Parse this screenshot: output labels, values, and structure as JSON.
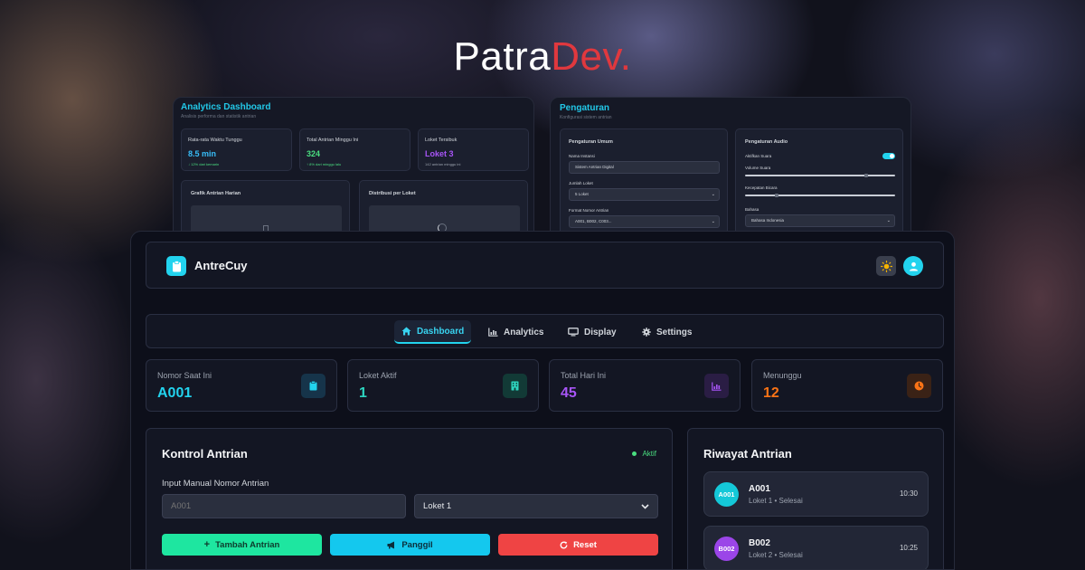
{
  "brand": {
    "part1": "Patra",
    "part2": "Dev."
  },
  "analytics_panel": {
    "title": "Analytics Dashboard",
    "subtitle": "Analisis performa dan statistik antrian",
    "cards": [
      {
        "label": "Rata-rata Waktu Tunggu",
        "value": "8.5 min",
        "note": "↓ 12% dari kemarin",
        "color": "#38bdf8",
        "note_color": "#4ade80"
      },
      {
        "label": "Total Antrian Minggu Ini",
        "value": "324",
        "note": "↑ 8% dari minggu lalu",
        "color": "#4ade80",
        "note_color": "#4ade80"
      },
      {
        "label": "Loket Tersibuk",
        "value": "Loket 3",
        "note": "142 antrian minggu ini",
        "color": "#a855f7",
        "note_color": "#9ca3af"
      }
    ],
    "chart1_title": "Grafik Antrian Harian",
    "chart2_title": "Distribusi per Loket"
  },
  "settings_panel": {
    "title": "Pengaturan",
    "subtitle": "Konfigurasi sistem antrian",
    "general": {
      "title": "Pengaturan Umum",
      "instansi_label": "Nama Instansi",
      "instansi_value": "Sistem Antrian Digital",
      "loket_label": "Jumlah Loket",
      "loket_value": "5 Loket",
      "format_label": "Format Nomor Antrian",
      "format_value": "A001, B002, C003..."
    },
    "audio": {
      "title": "Pengaturan Audio",
      "suara_label": "Aktifkan Suara",
      "volume_label": "Volume Suara",
      "volume_level": 0.8,
      "speed_label": "Kecepatan Bicara",
      "speed_level": 0.2,
      "bahasa_label": "Bahasa",
      "bahasa_value": "Bahasa Indonesia"
    }
  },
  "header": {
    "app_name": "AntreCuy"
  },
  "nav": {
    "tabs": [
      "Dashboard",
      "Analytics",
      "Display",
      "Settings"
    ]
  },
  "stats": [
    {
      "label": "Nomor Saat Ini",
      "value": "A001",
      "color": "#22d3ee",
      "icon": "clipboard-icon"
    },
    {
      "label": "Loket Aktif",
      "value": "1",
      "color": "#2dd4bf",
      "icon": "building-icon"
    },
    {
      "label": "Total Hari Ini",
      "value": "45",
      "color": "#a855f7",
      "icon": "chart-icon"
    },
    {
      "label": "Menunggu",
      "value": "12",
      "color": "#f97316",
      "icon": "clock-icon"
    }
  ],
  "kontrol": {
    "title": "Kontrol Antrian",
    "status": "Aktif",
    "input_label": "Input Manual Nomor Antrian",
    "input_placeholder": "A001",
    "select_value": "Loket 1",
    "btn_add": "Tambah Antrian",
    "btn_call": "Panggil",
    "btn_reset": "Reset"
  },
  "riwayat": {
    "title": "Riwayat Antrian",
    "items": [
      {
        "code": "A001",
        "sub": "Loket 1 • Selesai",
        "time": "10:30",
        "color": "#22d3ee"
      },
      {
        "code": "B002",
        "sub": "Loket 2 • Selesai",
        "time": "10:25",
        "color": "#a855f7"
      }
    ]
  }
}
